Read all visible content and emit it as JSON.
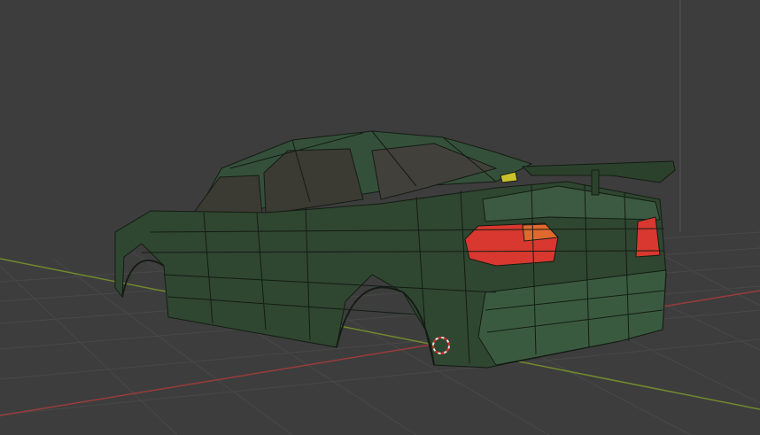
{
  "viewport": {
    "background_color": "#3d3d3d",
    "grid_line_color": "#484848",
    "x_axis_color": "#9a3b3b",
    "y_axis_color": "#6f8a2d",
    "mesh_body_color": "#2f4630",
    "mesh_wire_color": "#141c14",
    "taillight_color": "#d8382f",
    "taillight_amber_color": "#e0692f",
    "object_name": "car body mesh",
    "overlay_icon": "3d-cursor-icon"
  }
}
